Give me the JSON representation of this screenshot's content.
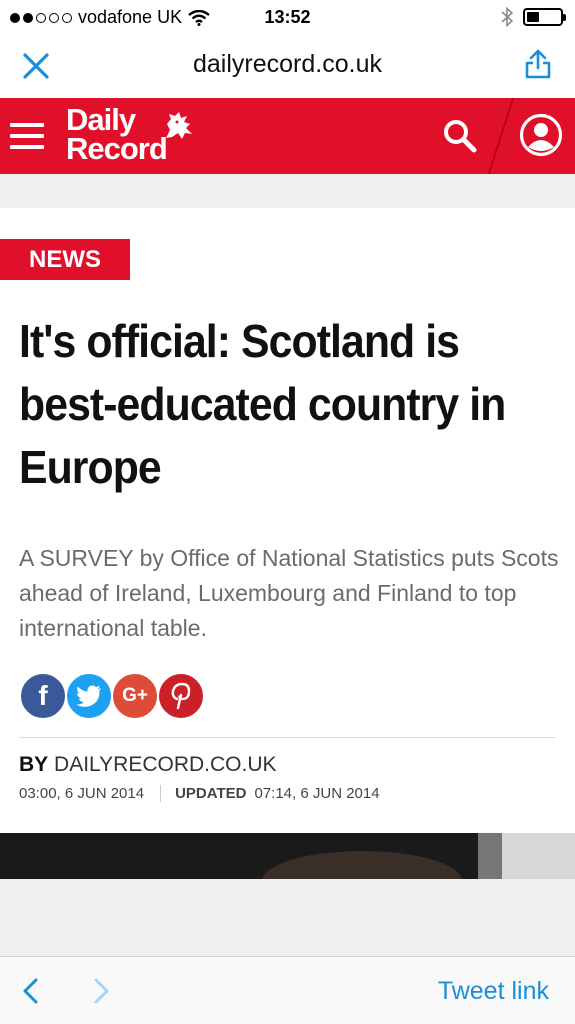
{
  "status_bar": {
    "carrier": "vodafone UK",
    "time": "13:52"
  },
  "browser": {
    "host": "dailyrecord.co.uk"
  },
  "site": {
    "logo_line1": "Daily",
    "logo_line2": "Record",
    "brand_color": "#e0102b"
  },
  "article": {
    "section": "NEWS",
    "headline": "It's official: Scotland is best-educated country in Europe",
    "standfirst": "A SURVEY by Office of National Statistics puts Scots ahead of Ireland, Luxembourg and Finland to top international table.",
    "social": {
      "facebook": "f",
      "google_plus": "G+",
      "pinterest": "P"
    },
    "byline_prefix": "BY",
    "byline_author": "DAILYRECORD.CO.UK",
    "published": "03:00, 6 JUN 2014",
    "updated_label": "UPDATED",
    "updated": "07:14, 6 JUN 2014"
  },
  "toolbar": {
    "tweet_label": "Tweet link"
  }
}
